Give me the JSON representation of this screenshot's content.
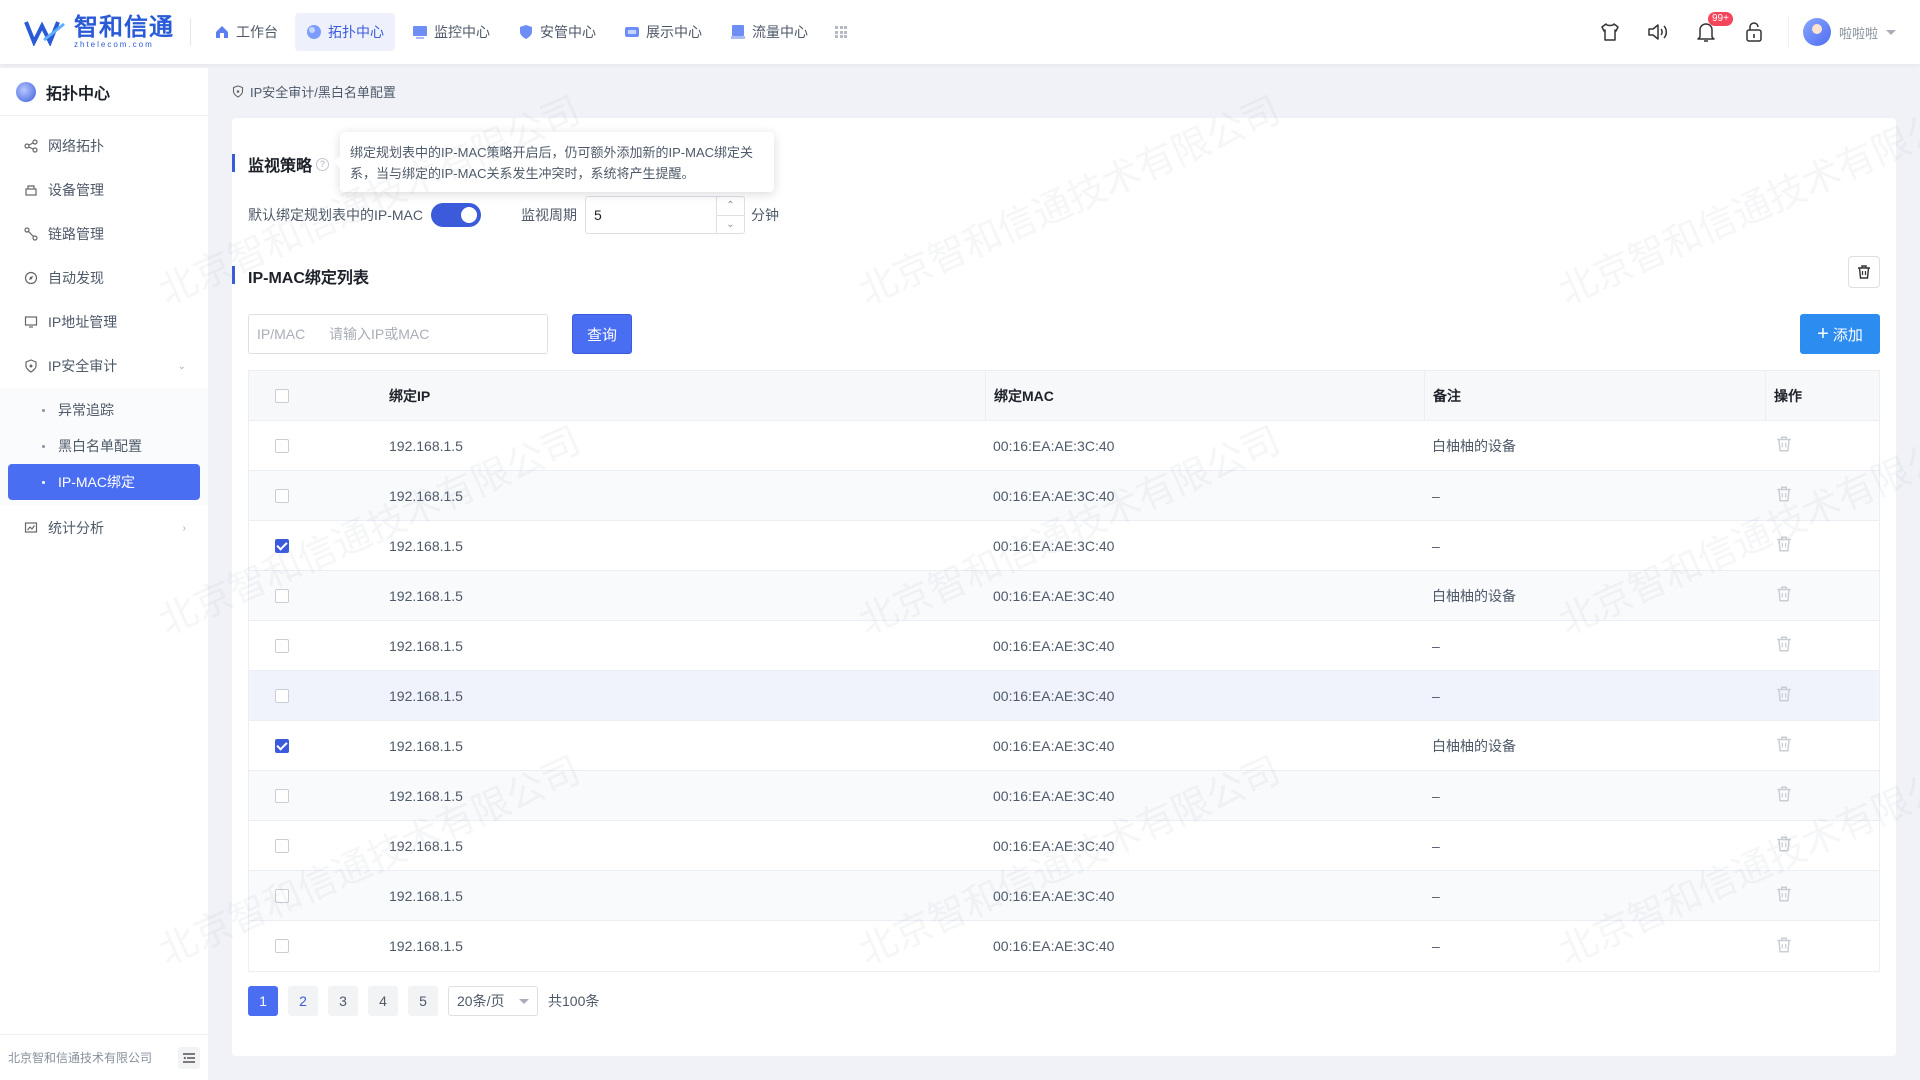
{
  "brand": {
    "name_cn": "智和信通",
    "name_en": "zhtelecom.com"
  },
  "nav": [
    {
      "label": "工作台",
      "icon": "home-icon",
      "active": false
    },
    {
      "label": "拓扑中心",
      "icon": "topology-icon",
      "active": true
    },
    {
      "label": "监控中心",
      "icon": "monitor-icon",
      "active": false
    },
    {
      "label": "安管中心",
      "icon": "shield-icon",
      "active": false
    },
    {
      "label": "展示中心",
      "icon": "display-icon",
      "active": false
    },
    {
      "label": "流量中心",
      "icon": "traffic-icon",
      "active": false
    }
  ],
  "topbar": {
    "notification_badge": "99+",
    "user_name": "啦啦啦"
  },
  "sidebar": {
    "title": "拓扑中心",
    "items": [
      "网络拓扑",
      "设备管理",
      "链路管理",
      "自动发现",
      "IP地址管理",
      "IP安全审计"
    ],
    "sub_items": [
      "异常追踪",
      "黑白名单配置",
      "IP-MAC绑定"
    ],
    "after_items": [
      "统计分析"
    ],
    "footer": "北京智和信通技术有限公司"
  },
  "breadcrumb": "IP安全审计/黑白名单配置",
  "policy": {
    "title": "监视策略",
    "tooltip": "绑定规划表中的IP-MAC策略开启后，仍可额外添加新的IP-MAC绑定关系，当与绑定的IP-MAC关系发生冲突时，系统将产生提醒。",
    "default_label": "默认绑定规划表中的IP-MAC",
    "toggle_on": true,
    "period_label": "监视周期",
    "period_value": "5",
    "period_unit": "分钟"
  },
  "list": {
    "title": "IP-MAC绑定列表",
    "search_label": "IP/MAC",
    "search_placeholder": "请输入IP或MAC",
    "query_button": "查询",
    "add_button": "添加"
  },
  "table": {
    "headers": [
      "绑定IP",
      "绑定MAC",
      "备注",
      "操作"
    ],
    "rows": [
      {
        "ip": "192.168.1.5",
        "mac": "00:16:EA:AE:3C:40",
        "note": "白柚柚的设备",
        "checked": false
      },
      {
        "ip": "192.168.1.5",
        "mac": "00:16:EA:AE:3C:40",
        "note": "–",
        "checked": false
      },
      {
        "ip": "192.168.1.5",
        "mac": "00:16:EA:AE:3C:40",
        "note": "–",
        "checked": true
      },
      {
        "ip": "192.168.1.5",
        "mac": "00:16:EA:AE:3C:40",
        "note": "白柚柚的设备",
        "checked": false
      },
      {
        "ip": "192.168.1.5",
        "mac": "00:16:EA:AE:3C:40",
        "note": "–",
        "checked": false
      },
      {
        "ip": "192.168.1.5",
        "mac": "00:16:EA:AE:3C:40",
        "note": "–",
        "checked": false
      },
      {
        "ip": "192.168.1.5",
        "mac": "00:16:EA:AE:3C:40",
        "note": "白柚柚的设备",
        "checked": true
      },
      {
        "ip": "192.168.1.5",
        "mac": "00:16:EA:AE:3C:40",
        "note": "–",
        "checked": false
      },
      {
        "ip": "192.168.1.5",
        "mac": "00:16:EA:AE:3C:40",
        "note": "–",
        "checked": false
      },
      {
        "ip": "192.168.1.5",
        "mac": "00:16:EA:AE:3C:40",
        "note": "–",
        "checked": false
      },
      {
        "ip": "192.168.1.5",
        "mac": "00:16:EA:AE:3C:40",
        "note": "–",
        "checked": false
      }
    ]
  },
  "pagination": {
    "pages": [
      "1",
      "2",
      "3",
      "4",
      "5"
    ],
    "current": "1",
    "page_size": "20条/页",
    "total": "共100条"
  },
  "watermark": "北京智和信通技术有限公司",
  "colors": {
    "primary": "#3b5bdb",
    "add_button": "#2d8cf0",
    "badge": "#f5455c"
  }
}
